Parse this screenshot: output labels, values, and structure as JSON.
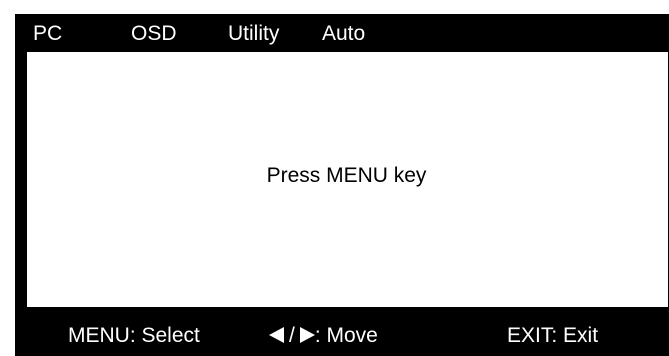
{
  "menu": {
    "tabs": [
      "PC",
      "OSD",
      "Utility",
      "Auto"
    ]
  },
  "content": {
    "prompt": "Press MENU key"
  },
  "footer": {
    "select_hint": "MENU: Select",
    "move_separator": "/",
    "move_hint": ": Move",
    "exit_hint": "EXIT: Exit"
  },
  "icons": {
    "left": "left-triangle-icon",
    "right": "right-triangle-icon"
  },
  "colors": {
    "frame": "#000000",
    "panel": "#ffffff",
    "text_on_frame": "#ffffff",
    "text_on_panel": "#000000"
  }
}
